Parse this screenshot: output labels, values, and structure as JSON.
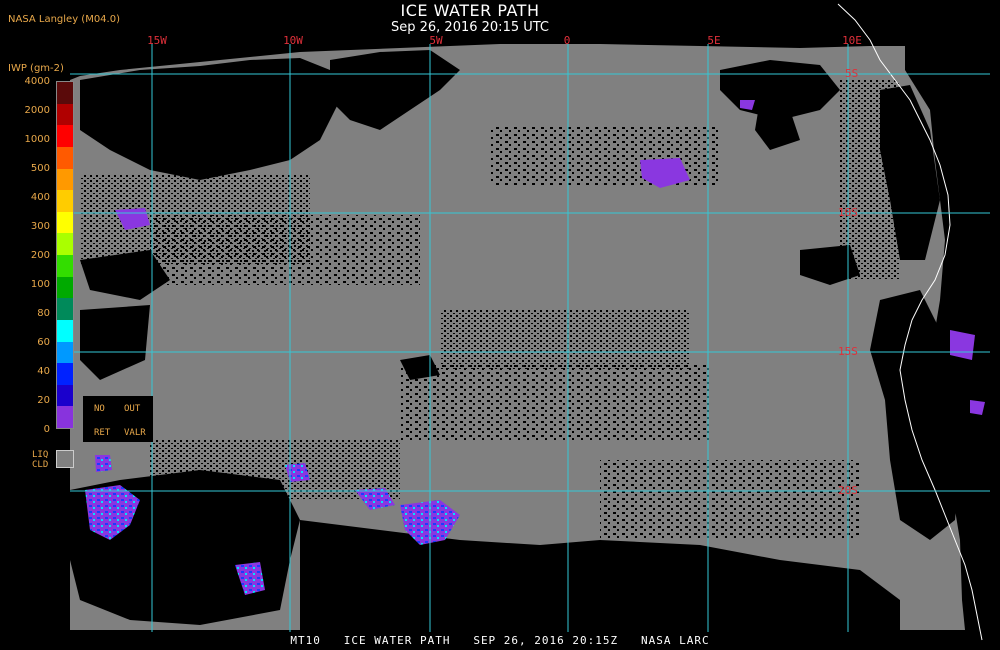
{
  "header": {
    "title": "ICE WATER PATH",
    "subtitle": "Sep 26, 2016 20:15 UTC",
    "provider": "NASA Langley (M04.0)"
  },
  "longitudes": [
    "15W",
    "10W",
    "5W",
    "0",
    "5E",
    "10E"
  ],
  "latitudes": [
    "5S",
    "10S",
    "15S",
    "20S"
  ],
  "legend": {
    "title": "IWP (gm-2)",
    "ticks": [
      "4000",
      "2000",
      "1000",
      "500",
      "400",
      "300",
      "200",
      "100",
      "80",
      "60",
      "40",
      "20",
      "0"
    ],
    "colors": [
      "#5a0a0a",
      "#b00000",
      "#ff0000",
      "#ff5a00",
      "#ff9900",
      "#ffcc00",
      "#ffff00",
      "#aaff00",
      "#33dd00",
      "#00aa00",
      "#008a5a",
      "#00ffff",
      "#0099ff",
      "#0022ff",
      "#1a00cc",
      "#8833dd"
    ],
    "no_ret": [
      "NO",
      "RET"
    ],
    "out_valr": [
      "OUT",
      "VALR"
    ],
    "liq_cld": [
      "LIQ",
      "CLD"
    ]
  },
  "footer": "MT10   ICE WATER PATH   SEP 26, 2016 20:15Z   NASA LARC"
}
